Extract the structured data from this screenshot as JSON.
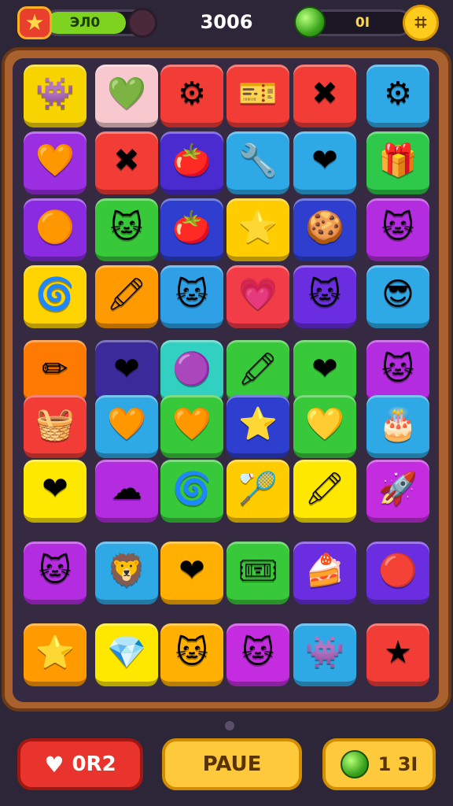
{
  "hud": {
    "level_icon": "star-icon",
    "xp_text": "ЭЛ0",
    "xp_progress": 0.8,
    "score": "3006",
    "gems": "0I",
    "gem_icon": "green-gem-icon",
    "menu_icon": "menu-grid-icon"
  },
  "board": {
    "rows": [
      [
        {
          "name": "green-monster",
          "glyph": "👾",
          "color": "#f7d400"
        },
        {
          "name": "heart",
          "glyph": "💚",
          "color": "#f7c9cf"
        },
        {
          "name": "blue-gear",
          "glyph": "⚙",
          "color": "#f23c36"
        },
        {
          "name": "ticket",
          "glyph": "🎫",
          "color": "#f23c36"
        },
        {
          "name": "purple-x",
          "glyph": "✖",
          "color": "#f23c36"
        },
        {
          "name": "gear-ring",
          "glyph": "⚙",
          "color": "#2fa8e6"
        }
      ],
      [
        {
          "name": "heart",
          "glyph": "🧡",
          "color": "#9b2ee0"
        },
        {
          "name": "yellow-x",
          "glyph": "✖",
          "color": "#f23c36"
        },
        {
          "name": "tomato",
          "glyph": "🍅",
          "color": "#4a2bd0"
        },
        {
          "name": "wand",
          "glyph": "🔧",
          "color": "#2fa8e6"
        },
        {
          "name": "heart",
          "glyph": "❤",
          "color": "#2fa8e6"
        },
        {
          "name": "gift-box",
          "glyph": "🎁",
          "color": "#2ec84a"
        }
      ],
      [
        {
          "name": "orange-blob",
          "glyph": "🟠",
          "color": "#8a2be2"
        },
        {
          "name": "white-cat",
          "glyph": "🐱",
          "color": "#38c93a"
        },
        {
          "name": "tomato",
          "glyph": "🍅",
          "color": "#2e3fd0"
        },
        {
          "name": "blue-star",
          "glyph": "⭐",
          "color": "#ffcc00"
        },
        {
          "name": "cookie",
          "glyph": "🍪",
          "color": "#2e3fd0"
        },
        {
          "name": "yellow-cat",
          "glyph": "🐱",
          "color": "#b42ce0"
        }
      ],
      [
        {
          "name": "swirl",
          "glyph": "🌀",
          "color": "#ffd400"
        },
        {
          "name": "blue-crayon",
          "glyph": "🖍",
          "color": "#ff9a00"
        },
        {
          "name": "green-cat",
          "glyph": "🐱",
          "color": "#2fa0e6"
        },
        {
          "name": "pink-gem",
          "glyph": "💗",
          "color": "#f23c48"
        },
        {
          "name": "yellow-cat",
          "glyph": "🐱",
          "color": "#6a2ee0"
        },
        {
          "name": "hat-face",
          "glyph": "😎",
          "color": "#2fa8e6"
        }
      ],
      [
        {
          "name": "pencil",
          "glyph": "✏",
          "color": "#ff7a00"
        },
        {
          "name": "heart",
          "glyph": "❤",
          "color": "#3a2a9a"
        },
        {
          "name": "purple-ring",
          "glyph": "🟣",
          "color": "#32d0c0"
        },
        {
          "name": "crayon",
          "glyph": "🖍",
          "color": "#38c93a"
        },
        {
          "name": "heart",
          "glyph": "❤",
          "color": "#38c93a"
        },
        {
          "name": "green-cat",
          "glyph": "🐱",
          "color": "#b42ce0"
        }
      ],
      [
        {
          "name": "gift-basket",
          "glyph": "🧺",
          "color": "#f23c36"
        },
        {
          "name": "heart",
          "glyph": "🧡",
          "color": "#2fa8e6"
        },
        {
          "name": "heart",
          "glyph": "🧡",
          "color": "#38c93a"
        },
        {
          "name": "yellow-star",
          "glyph": "⭐",
          "color": "#2e3fd0"
        },
        {
          "name": "heart",
          "glyph": "💛",
          "color": "#38c93a"
        },
        {
          "name": "cake",
          "glyph": "🎂",
          "color": "#2fa8e6"
        }
      ],
      [
        {
          "name": "heart",
          "glyph": "❤",
          "color": "#ffe800"
        },
        {
          "name": "blue-cloud",
          "glyph": "☁",
          "color": "#b42ce0"
        },
        {
          "name": "spiral",
          "glyph": "🌀",
          "color": "#38c93a"
        },
        {
          "name": "racket",
          "glyph": "🏸",
          "color": "#ffcc00"
        },
        {
          "name": "blue-crayon",
          "glyph": "🖍",
          "color": "#ffe800"
        },
        {
          "name": "rocket",
          "glyph": "🚀",
          "color": "#c42ce0"
        }
      ],
      [
        {
          "name": "green-cat",
          "glyph": "🐱",
          "color": "#b42ce0"
        },
        {
          "name": "orange-cat",
          "glyph": "🦁",
          "color": "#2fa8e6"
        },
        {
          "name": "heart",
          "glyph": "❤",
          "color": "#ffb000"
        },
        {
          "name": "purple-ticket",
          "glyph": "🎟",
          "color": "#38c93a"
        },
        {
          "name": "cake-slice",
          "glyph": "🍰",
          "color": "#6a2ee0"
        },
        {
          "name": "green-button",
          "glyph": "🔴",
          "color": "#6a2ee0"
        }
      ],
      [
        {
          "name": "blue-star",
          "glyph": "⭐",
          "color": "#ff9a00"
        },
        {
          "name": "blue-diamond",
          "glyph": "💎",
          "color": "#ffe800"
        },
        {
          "name": "purple-cat",
          "glyph": "🐱",
          "color": "#ffb000"
        },
        {
          "name": "orange-cat",
          "glyph": "🐱",
          "color": "#c42ce0"
        },
        {
          "name": "green-monster",
          "glyph": "👾",
          "color": "#2fa8e6"
        },
        {
          "name": "gold-star",
          "glyph": "★",
          "color": "#f23c36"
        }
      ]
    ]
  },
  "bottom": {
    "lives_icon": "heart-icon",
    "lives_label": "0R2",
    "pause_label": "PAUE",
    "coins_icon": "green-coin-icon",
    "coins_label": "1 3I"
  }
}
